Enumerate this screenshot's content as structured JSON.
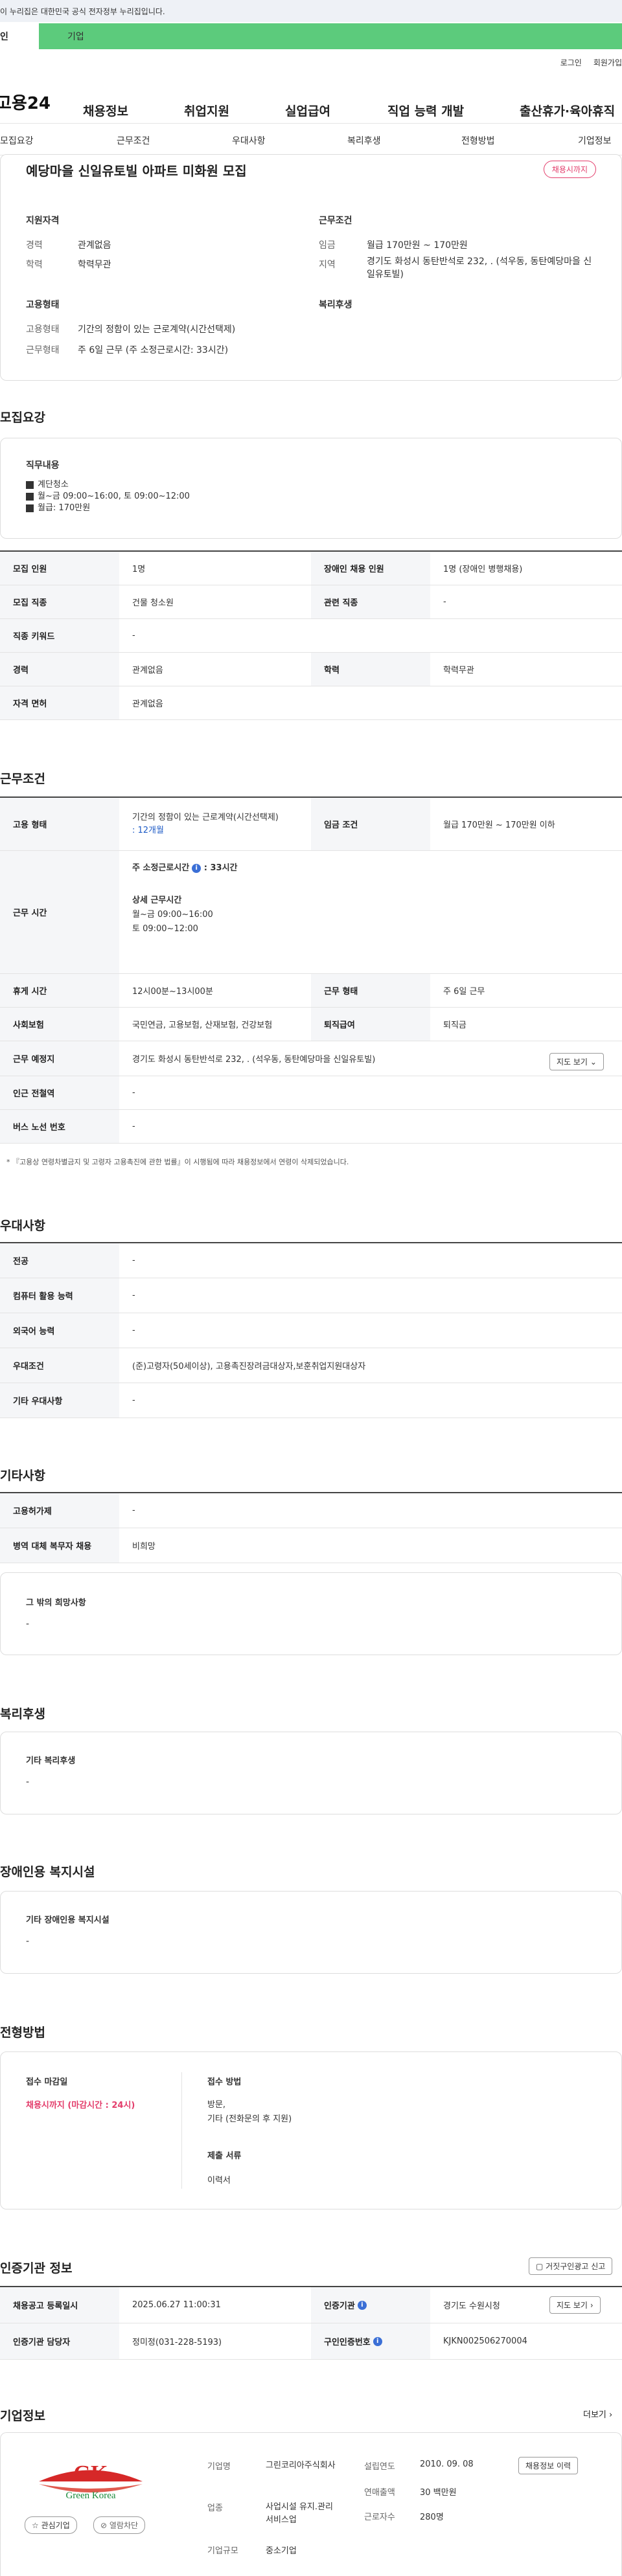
{
  "gov_banner": "이 누리집은 대한민국 공식 전자정부 누리집입니다.",
  "tabs": {
    "personal": "인",
    "company": "기업"
  },
  "util": {
    "login": "로그인",
    "join": "회원가입"
  },
  "logo": "고용24",
  "gnb": [
    "채용정보",
    "취업지원",
    "실업급여",
    "직업 능력 개발",
    "출산휴가·육아휴직"
  ],
  "subnav": [
    "모집요강",
    "근무조건",
    "우대사항",
    "복리후생",
    "전형방법",
    "기업정보"
  ],
  "job": {
    "title": "예당마을 신일유토빌 아파트 미화원 모집",
    "status_badge": "채용시까지",
    "qual_label": "지원자격",
    "career_k": "경력",
    "career_v": "관계없음",
    "edu_k": "학력",
    "edu_v": "학력무관",
    "cond_label": "근무조건",
    "wage_k": "임금",
    "wage_v": "월급 170만원 ~ 170만원",
    "area_k": "지역",
    "area_v": "경기도 화성시 동탄반석로 232, . (석우동, 동탄예당마을 신일유토빌)",
    "emp_label": "고용형태",
    "emp_k": "고용형태",
    "emp_v": "기간의 정함이 있는 근로계약(시간선택제)",
    "hours_k": "근무형태",
    "hours_v": "주 6일 근무 (주 소정근로시간: 33시간)",
    "welfare_label": "복리후생"
  },
  "recruit": {
    "heading": "모집요강",
    "duty_label": "직무내용",
    "duty_lines": [
      "계단청소",
      "월~금 09:00~16:00, 토 09:00~12:00",
      "월급: 170만원"
    ],
    "rows": [
      [
        "모집 인원",
        "1명",
        "장애인 채용 인원",
        "1명 (장애인 병행채용)"
      ],
      [
        "모집 직종",
        "건물 청소원",
        "관련 직종",
        "-"
      ],
      [
        "직종 키워드",
        "-"
      ],
      [
        "경력",
        "관계없음",
        "학력",
        "학력무관"
      ],
      [
        "자격 면허",
        "관계없음"
      ]
    ]
  },
  "conditions": {
    "heading": "근무조건",
    "emp_th": "고용 형태",
    "emp_td": "기간의 정함이 있는 근로계약(시간선택제)",
    "emp_period": ": 12개월",
    "wage_th": "임금 조건",
    "wage_td": "월급 170만원 ~ 170만원 이하",
    "time_th": "근무 시간",
    "weekly": "주 소정근로시간",
    "weekly_v": ": 33시간",
    "detail_label": "상세 근무시간",
    "detail_1": "월~금 09:00~16:00",
    "detail_2": "토 09:00~12:00",
    "rows": [
      [
        "휴게 시간",
        "12시00분~13시00분",
        "근무 형태",
        "주 6일 근무"
      ],
      [
        "사회보험",
        "국민연금, 고용보험, 산재보험, 건강보험",
        "퇴직급여",
        "퇴직금"
      ]
    ],
    "place_th": "근무 예정지",
    "place_td": "경기도 화성시 동탄반석로 232, . (석우동, 동탄예당마을 신일유토빌)",
    "map_btn": "지도 보기",
    "station_th": "인근 전철역",
    "station_td": "-",
    "bus_th": "버스 노선 번호",
    "bus_td": "-",
    "note": "* 『고용상 연령차별금지 및 고령자 고용촉진에 관한 법률』이 시행됨에 따라 채용정보에서 연령이 삭제되었습니다."
  },
  "prefer": {
    "heading": "우대사항",
    "rows": [
      [
        "전공",
        "-"
      ],
      [
        "컴퓨터 활용 능력",
        "-"
      ],
      [
        "외국어 능력",
        "-"
      ],
      [
        "우대조건",
        "(준)고령자(50세이상), 고용촉진장려금대상자,보훈취업지원대상자"
      ],
      [
        "기타 우대사항",
        "-"
      ]
    ]
  },
  "etc": {
    "heading": "기타사항",
    "rows": [
      [
        "고용허가제",
        "-"
      ],
      [
        "병역 대체 복무자 채용",
        "비희망"
      ]
    ],
    "wish_label": "그 밖의 희망사항",
    "wish_v": "-"
  },
  "welfare": {
    "heading": "복리후생",
    "label": "기타 복리후생",
    "value": "-"
  },
  "disability": {
    "heading": "장애인용 복지시설",
    "label": "기타 장애인용 복지시설",
    "value": "-"
  },
  "screening": {
    "heading": "전형방법",
    "deadline_label": "접수 마감일",
    "deadline_v": "채용시까지 (마감시간 : 24시)",
    "method_label": "접수 방법",
    "method_1": "방문,",
    "method_2": "기타 (전화문의 후 지원)",
    "docs_label": "제출 서류",
    "docs_v": "이력서"
  },
  "auth": {
    "heading": "인증기관 정보",
    "report_btn": "거짓구인광고 신고",
    "rows": [
      [
        "채용공고 등록일시",
        "2025.06.27 11:00:31",
        "인증기관",
        "경기도 수원시청"
      ],
      [
        "인증기관 담당자",
        "정미정(031-228-5193)",
        "구인인증번호",
        "KJKN002506270004"
      ]
    ],
    "map_btn": "지도 보기"
  },
  "company": {
    "heading": "기업정보",
    "more": "더보기",
    "logo_text": "GK",
    "logo_sub": "Green Korea",
    "interest_btn": "관심기업",
    "block_btn": "열람차단",
    "name_k": "기업명",
    "name_v": "그린코리아주식회사",
    "founded_k": "설립연도",
    "founded_v": "2010. 09. 08",
    "jobs_btn": "채용정보 이력",
    "biz_k": "업종",
    "biz_v": "사업시설 유지.관리 서비스업",
    "sales_k": "연매출액",
    "sales_v": "30 백만원",
    "staff_k": "근로자수",
    "staff_v": "280명",
    "size_k": "기업규모",
    "size_v": "중소기업"
  }
}
